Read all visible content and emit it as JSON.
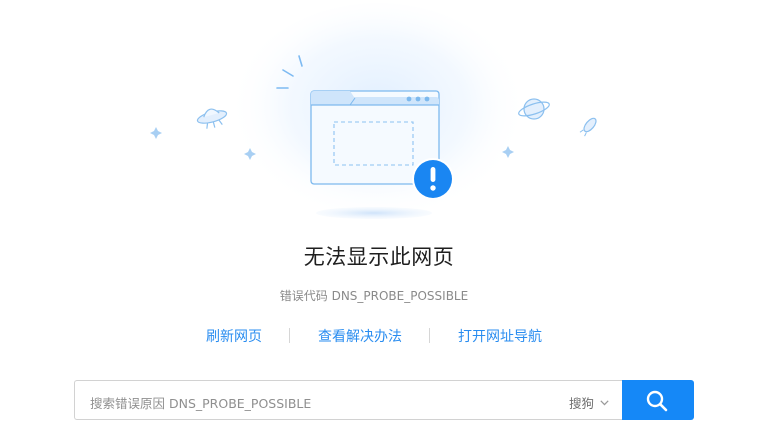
{
  "page": {
    "title": "无法显示此网页",
    "error_code_label": "错误代码 DNS_PROBE_POSSIBLE"
  },
  "actions": {
    "refresh_label": "刷新网页",
    "solutions_label": "查看解决办法",
    "navigation_label": "打开网址导航"
  },
  "search": {
    "placeholder": "搜索错误原因 DNS_PROBE_POSSIBLE",
    "engine_selected": "搜狗",
    "button_icon": "search-icon"
  },
  "illustration": {
    "icons": [
      "browser-window-icon",
      "warning-icon",
      "ufo-icon",
      "planet-icon",
      "rocket-icon",
      "sparkle-icon"
    ]
  },
  "colors": {
    "accent": "#1588f7",
    "link": "#2a8df0",
    "illustration_blue": "#6fb3f0",
    "warning_bg": "#1a86f2"
  }
}
